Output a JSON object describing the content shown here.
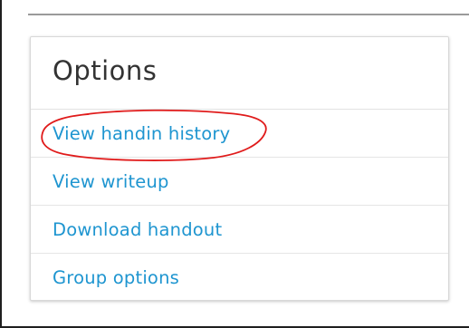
{
  "options_card": {
    "title": "Options",
    "items": [
      {
        "label": "View handin history"
      },
      {
        "label": "View writeup"
      },
      {
        "label": "Download handout"
      },
      {
        "label": "Group options"
      }
    ]
  },
  "annotation": {
    "target": "View handin history",
    "color": "#e01b1b"
  },
  "colors": {
    "link": "#1e95d0",
    "title": "#333333",
    "divider": "#e5e5e5"
  }
}
